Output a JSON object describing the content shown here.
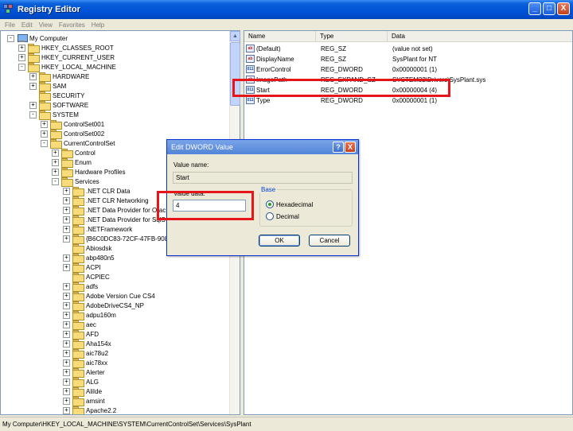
{
  "window": {
    "title": "Registry Editor",
    "min": "_",
    "max": "□",
    "close": "X"
  },
  "menu": [
    "File",
    "Edit",
    "View",
    "Favorites",
    "Help"
  ],
  "tree": [
    {
      "label": "My Computer",
      "indent": 0,
      "exp": "-",
      "icon": "computer"
    },
    {
      "label": "HKEY_CLASSES_ROOT",
      "indent": 1,
      "exp": "+"
    },
    {
      "label": "HKEY_CURRENT_USER",
      "indent": 1,
      "exp": "+"
    },
    {
      "label": "HKEY_LOCAL_MACHINE",
      "indent": 1,
      "exp": "-"
    },
    {
      "label": "HARDWARE",
      "indent": 2,
      "exp": "+"
    },
    {
      "label": "SAM",
      "indent": 2,
      "exp": "+"
    },
    {
      "label": "SECURITY",
      "indent": 2,
      "exp": ""
    },
    {
      "label": "SOFTWARE",
      "indent": 2,
      "exp": "+"
    },
    {
      "label": "SYSTEM",
      "indent": 2,
      "exp": "-"
    },
    {
      "label": "ControlSet001",
      "indent": 3,
      "exp": "+"
    },
    {
      "label": "ControlSet002",
      "indent": 3,
      "exp": "+"
    },
    {
      "label": "CurrentControlSet",
      "indent": 3,
      "exp": "-"
    },
    {
      "label": "Control",
      "indent": 4,
      "exp": "+"
    },
    {
      "label": "Enum",
      "indent": 4,
      "exp": "+"
    },
    {
      "label": "Hardware Profiles",
      "indent": 4,
      "exp": "+"
    },
    {
      "label": "Services",
      "indent": 4,
      "exp": "-"
    },
    {
      "label": ".NET CLR Data",
      "indent": 5,
      "exp": "+"
    },
    {
      "label": ".NET CLR Networking",
      "indent": 5,
      "exp": "+"
    },
    {
      "label": ".NET Data Provider for Orac",
      "indent": 5,
      "exp": "+"
    },
    {
      "label": ".NET Data Provider for SqlS",
      "indent": 5,
      "exp": "+"
    },
    {
      "label": ".NETFramework",
      "indent": 5,
      "exp": "+"
    },
    {
      "label": "{B6C0DC83-72CF-47FB-908",
      "indent": 5,
      "exp": "+"
    },
    {
      "label": "Abiosdsk",
      "indent": 5,
      "exp": ""
    },
    {
      "label": "abp480n5",
      "indent": 5,
      "exp": "+"
    },
    {
      "label": "ACPI",
      "indent": 5,
      "exp": "+"
    },
    {
      "label": "ACPIEC",
      "indent": 5,
      "exp": ""
    },
    {
      "label": "adfs",
      "indent": 5,
      "exp": "+"
    },
    {
      "label": "Adobe Version Cue CS4",
      "indent": 5,
      "exp": "+"
    },
    {
      "label": "AdobeDriveCS4_NP",
      "indent": 5,
      "exp": "+"
    },
    {
      "label": "adpu160m",
      "indent": 5,
      "exp": "+"
    },
    {
      "label": "aec",
      "indent": 5,
      "exp": "+"
    },
    {
      "label": "AFD",
      "indent": 5,
      "exp": "+"
    },
    {
      "label": "Aha154x",
      "indent": 5,
      "exp": "+"
    },
    {
      "label": "aic78u2",
      "indent": 5,
      "exp": "+"
    },
    {
      "label": "aic78xx",
      "indent": 5,
      "exp": "+"
    },
    {
      "label": "Alerter",
      "indent": 5,
      "exp": "+"
    },
    {
      "label": "ALG",
      "indent": 5,
      "exp": "+"
    },
    {
      "label": "AliIde",
      "indent": 5,
      "exp": "+"
    },
    {
      "label": "amsint",
      "indent": 5,
      "exp": "+"
    },
    {
      "label": "Apache2.2",
      "indent": 5,
      "exp": "+"
    }
  ],
  "list": {
    "headers": [
      "Name",
      "Type",
      "Data"
    ],
    "rows": [
      {
        "name": "(Default)",
        "type": "REG_SZ",
        "data": "(value not set)",
        "kind": "sz"
      },
      {
        "name": "DisplayName",
        "type": "REG_SZ",
        "data": "SysPlant for NT",
        "kind": "sz"
      },
      {
        "name": "ErrorControl",
        "type": "REG_DWORD",
        "data": "0x00000001 (1)",
        "kind": "dw"
      },
      {
        "name": "ImagePath",
        "type": "REG_EXPAND_SZ",
        "data": "SYSTEM32\\Drivers\\SysPlant.sys",
        "kind": "sz"
      },
      {
        "name": "Start",
        "type": "REG_DWORD",
        "data": "0x00000004 (4)",
        "kind": "dw"
      },
      {
        "name": "Type",
        "type": "REG_DWORD",
        "data": "0x00000001 (1)",
        "kind": "dw"
      }
    ]
  },
  "status": "My Computer\\HKEY_LOCAL_MACHINE\\SYSTEM\\CurrentControlSet\\Services\\SysPlant",
  "dialog": {
    "title": "Edit DWORD Value",
    "help": "?",
    "close": "X",
    "value_name_label": "Value name:",
    "value_name": "Start",
    "value_data_label": "Value data:",
    "value_data": "4",
    "base_label": "Base",
    "hex_label": "Hexadecimal",
    "dec_label": "Decimal",
    "base_selected": "Hexadecimal",
    "ok": "OK",
    "cancel": "Cancel"
  },
  "colors": {
    "highlight": "#e5151a",
    "titlebar": "#0052d6"
  }
}
